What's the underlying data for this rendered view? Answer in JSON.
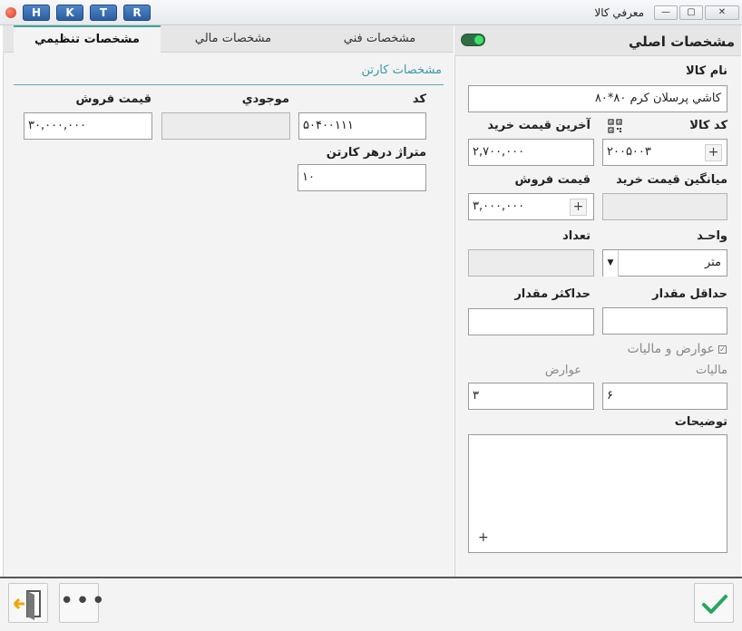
{
  "window": {
    "title": "معرفي کالا",
    "quick_buttons": [
      "H",
      "K",
      "T",
      "R"
    ],
    "controls": {
      "minimize": "—",
      "maximize": "▢",
      "close": "✕"
    }
  },
  "left_tabs": {
    "technical": "مشخصات فني",
    "financial": "مشخصات مالي",
    "settings": "مشخصات تنظيمي"
  },
  "carton": {
    "section_title": "مشخصات کارتن",
    "code_label": "کد",
    "code_value": "۵۰۴۰۰۱۱۱",
    "stock_label": "موجودي",
    "stock_value": "",
    "price_label": "قيمت فروش",
    "price_value": "۳۰,۰۰۰,۰۰۰",
    "meterage_label": "متراژ درهر کارتن",
    "meterage_value": "۱۰"
  },
  "main": {
    "header_title": "مشخصات اصلي",
    "name_label": "نام کالا",
    "name_value": "کاشي پرسلان کرم ۸۰*۸۰",
    "code_label": "کد کالا",
    "code_value": "۲۰۰۵۰۰۳",
    "last_buy_label": "آخرين قيمت خريد",
    "last_buy_value": "۲,۷۰۰,۰۰۰",
    "avg_buy_label": "ميانگين قيمت خريد",
    "avg_buy_value": "",
    "sell_price_label": "قيمت فروش",
    "sell_price_value": "۳,۰۰۰,۰۰۰",
    "unit_label": "واحـد",
    "unit_value": "متر",
    "count_label": "تعداد",
    "count_value": "",
    "min_qty_label": "حداقل مقدار",
    "min_qty_value": "",
    "max_qty_label": "حداکثر مقدار",
    "max_qty_value": "",
    "taxes_checkbox_label": "عوارض و ماليات",
    "tax_label": "ماليات",
    "tax_value": "۶",
    "duty_label": "عوارض",
    "duty_value": "۳",
    "notes_label": "توضيحات",
    "plus": "+"
  },
  "icons": {
    "app": "app-icon",
    "qr": "qr-code-icon",
    "exit": "exit-icon",
    "more": "more-dots-icon",
    "confirm": "checkmark-icon",
    "dropdown": "chevron-down-icon"
  },
  "colors": {
    "accent": "#3a9aa8",
    "toggle_on": "#3ee06c",
    "confirm_green": "#26a65b",
    "quick_button": "#2c5e9f"
  },
  "footer": {
    "more_label": "•••"
  }
}
